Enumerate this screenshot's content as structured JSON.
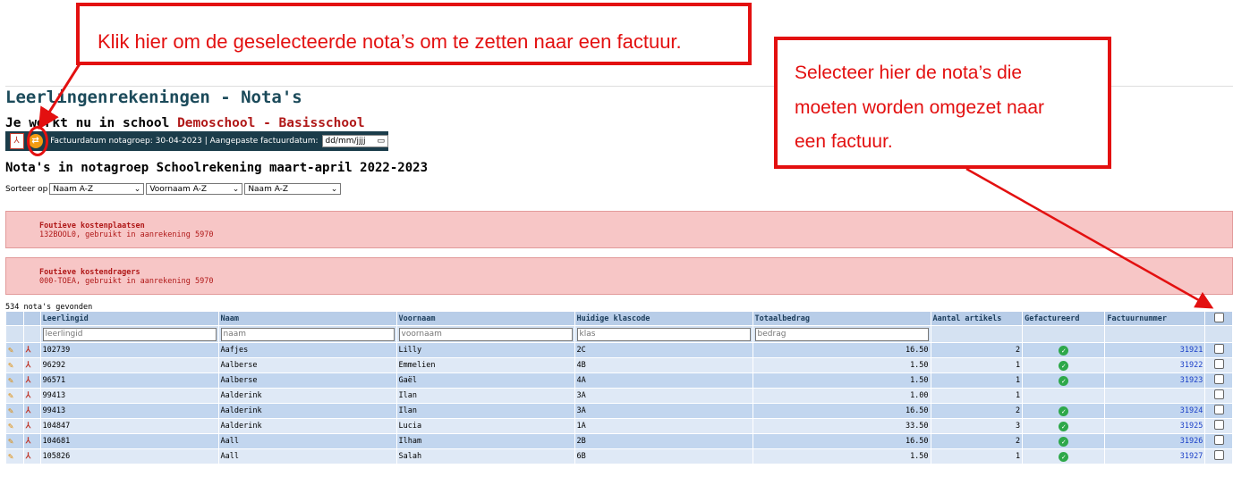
{
  "page": {
    "title": "Leerlingenrekeningen - Nota's",
    "school_prefix": "Je werkt nu in school ",
    "school_name": "Demoschool - Basisschool",
    "subtitle": "Nota's in notagroep Schoolrekening maart-april 2022-2023"
  },
  "toolbar": {
    "pdf_icon": "pdf-icon",
    "convert_icon": "convert-to-invoice-icon",
    "info_text": "Factuurdatum notagroep: 30-04-2023 | Aangepaste factuurdatum:",
    "date_placeholder": "dd/mm/jjjj"
  },
  "sort": {
    "label": "Sorteer op",
    "options": [
      "Naam A-Z",
      "Voornaam A-Z",
      "Naam A-Z"
    ]
  },
  "alerts": [
    {
      "title": "Foutieve kostenplaatsen",
      "text": "132BOOL0, gebruikt in aanrekening 5970"
    },
    {
      "title": "Foutieve kostendragers",
      "text": "000-TOEA, gebruikt in aanrekening 5970"
    }
  ],
  "results_count": "534 nota's gevonden",
  "table": {
    "headers": [
      "Leerlingid",
      "Naam",
      "Voornaam",
      "Huidige klascode",
      "Totaalbedrag",
      "Aantal artikels",
      "Gefactureerd",
      "Factuurnummer"
    ],
    "filters": [
      "leerlingid",
      "naam",
      "voornaam",
      "klas",
      "bedrag"
    ],
    "rows": [
      {
        "id": "102739",
        "naam": "Aafjes",
        "voornaam": "Lilly",
        "klas": "2C",
        "bedrag": "16.50",
        "artikels": "2",
        "gefactureerd": true,
        "factuur": "31921"
      },
      {
        "id": "96292",
        "naam": "Aalberse",
        "voornaam": "Emmelien",
        "klas": "4B",
        "bedrag": "1.50",
        "artikels": "1",
        "gefactureerd": true,
        "factuur": "31922"
      },
      {
        "id": "96571",
        "naam": "Aalberse",
        "voornaam": "Gaël",
        "klas": "4A",
        "bedrag": "1.50",
        "artikels": "1",
        "gefactureerd": true,
        "factuur": "31923"
      },
      {
        "id": "99413",
        "naam": "Aalderink",
        "voornaam": "Ilan",
        "klas": "3A",
        "bedrag": "1.00",
        "artikels": "1",
        "gefactureerd": false,
        "factuur": ""
      },
      {
        "id": "99413",
        "naam": "Aalderink",
        "voornaam": "Ilan",
        "klas": "3A",
        "bedrag": "16.50",
        "artikels": "2",
        "gefactureerd": true,
        "factuur": "31924"
      },
      {
        "id": "104847",
        "naam": "Aalderink",
        "voornaam": "Lucia",
        "klas": "1A",
        "bedrag": "33.50",
        "artikels": "3",
        "gefactureerd": true,
        "factuur": "31925"
      },
      {
        "id": "104681",
        "naam": "Aall",
        "voornaam": "Ilham",
        "klas": "2B",
        "bedrag": "16.50",
        "artikels": "2",
        "gefactureerd": true,
        "factuur": "31926"
      },
      {
        "id": "105826",
        "naam": "Aall",
        "voornaam": "Salah",
        "klas": "6B",
        "bedrag": "1.50",
        "artikels": "1",
        "gefactureerd": true,
        "factuur": "31927"
      }
    ]
  },
  "callouts": {
    "convert": "Klik hier om de geselecteerde nota’s om te zetten naar een factuur.",
    "select_lines": [
      "Selecteer hier de nota’s die",
      "moeten worden omgezet naar",
      "een factuur."
    ]
  },
  "colors": {
    "annotation": "#e31010",
    "toolbar": "#1b3c4a",
    "alert_bg": "#f7c6c6",
    "row_odd": "#c2d6ef",
    "row_even": "#dfe9f6"
  }
}
